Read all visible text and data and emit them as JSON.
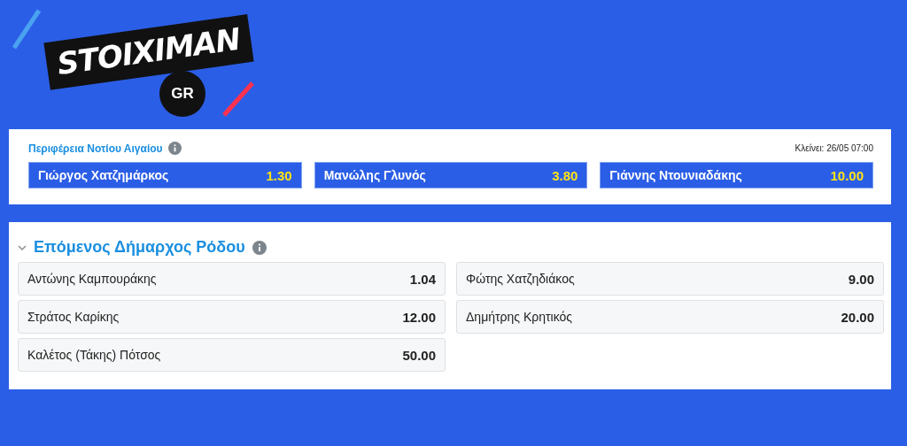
{
  "logo": {
    "wordmark": "STOIXIMAN",
    "badge": "GR"
  },
  "region_market": {
    "title": "Περιφέρεια Νοτίου Αιγαίου",
    "closes": "Κλείνει: 26/05 07:00",
    "odds": [
      {
        "name": "Γιώργος Χατζημάρκος",
        "price": "1.30"
      },
      {
        "name": "Μανώλης Γλυνός",
        "price": "3.80"
      },
      {
        "name": "Γιάννης Ντουνιαδάκης",
        "price": "10.00"
      }
    ]
  },
  "mayor_market": {
    "title": "Επόμενος Δήμαρχος Ρόδου",
    "expanded": true,
    "columns": [
      [
        {
          "name": "Αντώνης Καμπουράκης",
          "price": "1.04"
        },
        {
          "name": "Στράτος Καρίκης",
          "price": "12.00"
        },
        {
          "name": "Καλέτος (Τάκης) Πότσος",
          "price": "50.00"
        }
      ],
      [
        {
          "name": "Φώτης Χατζηδιάκος",
          "price": "9.00"
        },
        {
          "name": "Δημήτρης Κρητικός",
          "price": "20.00"
        }
      ]
    ]
  }
}
